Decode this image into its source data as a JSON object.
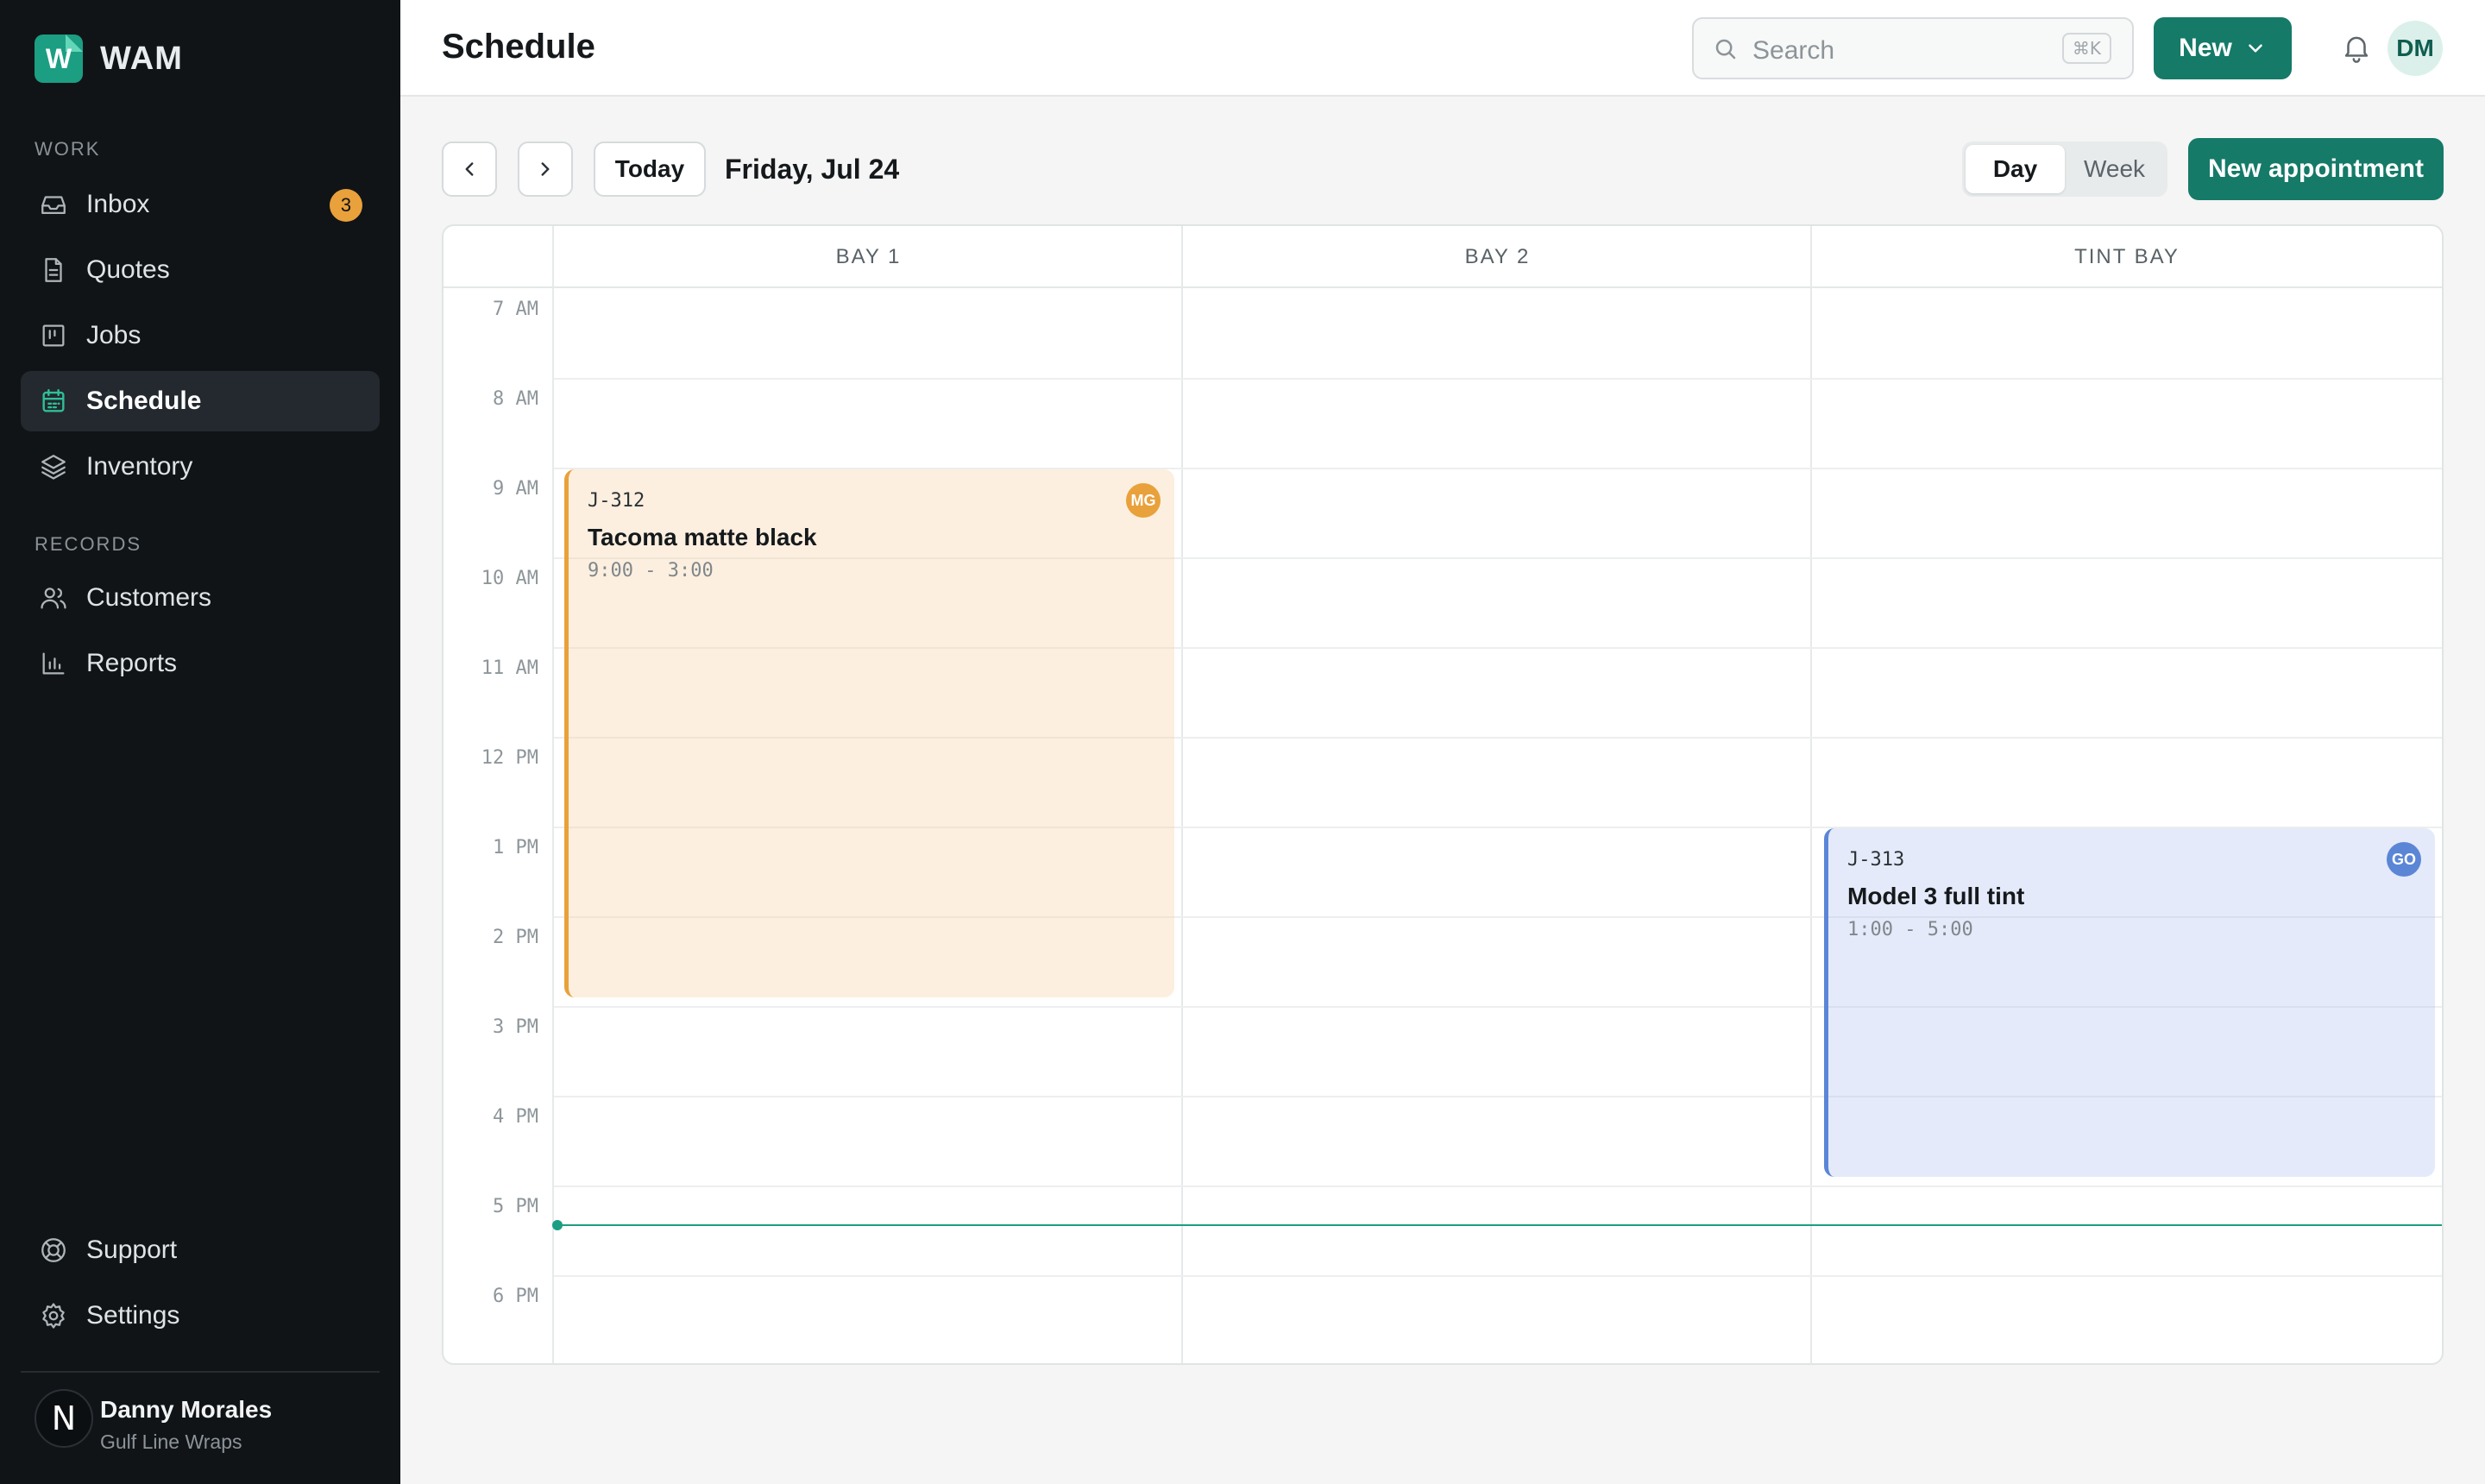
{
  "app": {
    "brand": "WAM",
    "logo_letter": "W",
    "accent_color": "#157a68"
  },
  "sidebar": {
    "work_label": "WORK",
    "records_label": "RECORDS",
    "work_items": [
      {
        "label": "Inbox",
        "icon": "inbox-icon",
        "badge": "3"
      },
      {
        "label": "Quotes",
        "icon": "document-icon"
      },
      {
        "label": "Jobs",
        "icon": "kanban-icon"
      },
      {
        "label": "Schedule",
        "icon": "calendar-icon",
        "active": true
      },
      {
        "label": "Inventory",
        "icon": "layers-icon"
      }
    ],
    "record_items": [
      {
        "label": "Customers",
        "icon": "users-icon"
      },
      {
        "label": "Reports",
        "icon": "bar-chart-icon"
      }
    ],
    "footer_items": [
      {
        "label": "Support",
        "icon": "lifebuoy-icon"
      },
      {
        "label": "Settings",
        "icon": "gear-icon"
      }
    ],
    "user": {
      "initial": "N",
      "name": "Danny Morales",
      "org": "Gulf Line Wraps"
    }
  },
  "header": {
    "title": "Schedule",
    "search_placeholder": "Search",
    "search_shortcut": "⌘K",
    "new_label": "New",
    "avatar_initials": "DM"
  },
  "toolbar": {
    "today_label": "Today",
    "date_label": "Friday, Jul 24",
    "views": [
      "Day",
      "Week"
    ],
    "active_view": "Day",
    "new_appointment_label": "New appointment"
  },
  "calendar": {
    "columns": [
      "BAY 1",
      "BAY 2",
      "TINT BAY"
    ],
    "hours": [
      "7 AM",
      "8 AM",
      "9 AM",
      "10 AM",
      "11 AM",
      "12 PM",
      "1 PM",
      "2 PM",
      "3 PM",
      "4 PM",
      "5 PM",
      "6 PM"
    ],
    "events": [
      {
        "code": "J-312",
        "title": "Tacoma matte black",
        "range": "9:00 - 3:00",
        "assignee": "MG",
        "bay": "BAY 1",
        "color": "#e9a13b"
      },
      {
        "code": "J-313",
        "title": "Model 3 full tint",
        "range": "1:00 - 5:00",
        "assignee": "GO",
        "bay": "TINT BAY",
        "color": "#5b86d6"
      }
    ]
  }
}
